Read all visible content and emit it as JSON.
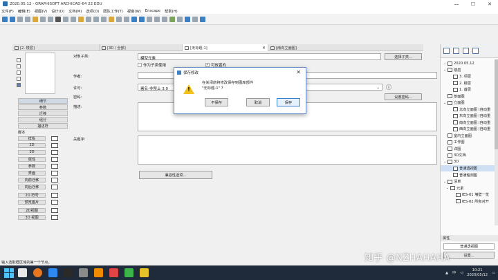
{
  "window": {
    "title": "2020.05.12 - GRAPHISOFT ARCHICAD-64 22 EDU",
    "controls": [
      "—",
      "☐",
      "✕"
    ]
  },
  "menu": [
    "文件(F)",
    "编辑(E)",
    "视图(V)",
    "设计(D)",
    "文档(M)",
    "选项(O)",
    "团队工作(T)",
    "视窗(W)",
    "Enscape",
    "帮助(H)"
  ],
  "tabs": [
    {
      "label": "[2. 楼层]"
    },
    {
      "label": "[3D / 全部]"
    },
    {
      "label": "[无标题-1]",
      "close": "✕"
    },
    {
      "label": "[南向立面图]"
    }
  ],
  "left_panel": {
    "categories": [
      "细节",
      "参数",
      "迁移",
      "组分",
      "描述符"
    ],
    "script_header": "脚本",
    "scripts": [
      "样板",
      "2D",
      "3D",
      "属性",
      "参数",
      "界面",
      "向前迁移",
      "向后迁移"
    ],
    "scripts2": [
      "2D 符号",
      "预览图片"
    ],
    "views": [
      "2D视图",
      "3D 视图"
    ]
  },
  "details": {
    "subtype_label": "对象子类:",
    "subtype_value": "模型元素",
    "select_subtype": "选择子类...",
    "checkbox_sub": "作为子类使用",
    "checkbox_placeable": "可放置的",
    "author_label": "作者:",
    "license_label": "许可:",
    "license_value": "署名-非禁止 3.0",
    "license_info": "ⓘ",
    "password_label": "密码:",
    "password_button": "设置密码...",
    "desc_label": "描述:",
    "keywords_label": "关键字:",
    "compat_button": "兼容性选项..."
  },
  "dialog": {
    "title": "保存修改",
    "line1": "在关闭前将修改保存到图库部件",
    "line2": "\"无标题-1\" ?",
    "dont_save": "不保存",
    "cancel": "取消",
    "save": "保存",
    "close": "✕"
  },
  "navigator": {
    "items": [
      {
        "label": "2020.05.12",
        "exp": "⌄"
      },
      {
        "label": "楼层",
        "exp": "⌄"
      },
      {
        "label": "3. 项层",
        "exp": ""
      },
      {
        "label": "2. 楼层",
        "exp": ""
      },
      {
        "label": "1. 首层",
        "exp": ""
      },
      {
        "label": "剖面图",
        "exp": ""
      },
      {
        "label": "立面图",
        "exp": "⌄"
      },
      {
        "label": "北向立面图 (自动重",
        "exp": ""
      },
      {
        "label": "东向立面图 (自动重",
        "exp": ""
      },
      {
        "label": "南向立面图 (自动重",
        "exp": ""
      },
      {
        "label": "西向立面图 (自动重",
        "exp": ""
      },
      {
        "label": "室内立面图",
        "exp": ""
      },
      {
        "label": "工作图",
        "exp": ""
      },
      {
        "label": "详图",
        "exp": ""
      },
      {
        "label": "3D文档",
        "exp": ""
      },
      {
        "label": "3D",
        "exp": "⌄"
      },
      {
        "label": "普通透视图",
        "exp": "",
        "selected": true
      },
      {
        "label": "普通轴测图",
        "exp": ""
      },
      {
        "label": "清单",
        "exp": "⌄"
      },
      {
        "label": "元素",
        "exp": "⌄"
      },
      {
        "label": "IES-01 墙壁一览",
        "exp": ""
      },
      {
        "label": "IES-02 所有对开",
        "exp": ""
      }
    ],
    "properties_header": "属性",
    "properties_value": "普通透视图",
    "settings_button": "设置..."
  },
  "status": "输入选取框区域的第一个节点。",
  "taskbar": {
    "tray_text": "中",
    "time": "10:21",
    "date": "2020/05/12"
  },
  "watermark": "知乎 @NZHAHAHA",
  "colors": {
    "accent": "#3c7fc2",
    "warning": "#f1c21b",
    "selection": "#cfe0f5",
    "taskbar": "#1f2b3a"
  }
}
